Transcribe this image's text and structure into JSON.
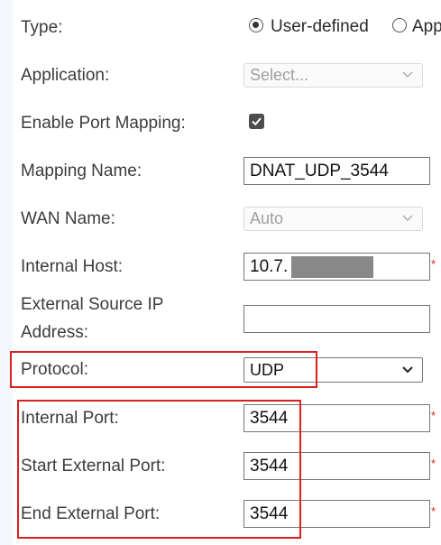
{
  "form": {
    "type": {
      "label": "Type:",
      "options": [
        "User-defined",
        "App"
      ],
      "selected": "User-defined"
    },
    "application": {
      "label": "Application:",
      "placeholder": "Select...",
      "disabled": true
    },
    "enable_port_mapping": {
      "label": "Enable Port Mapping:",
      "checked": true
    },
    "mapping_name": {
      "label": "Mapping Name:",
      "value": "DNAT_UDP_3544"
    },
    "wan_name": {
      "label": "WAN Name:",
      "value": "Auto",
      "disabled": true
    },
    "internal_host": {
      "label": "Internal Host:",
      "value": "10.7.",
      "required_mark": "*"
    },
    "external_source_ip": {
      "label_line1": "External Source IP",
      "label_line2": "Address:",
      "value": ""
    },
    "protocol": {
      "label": "Protocol:",
      "value": "UDP"
    },
    "internal_port": {
      "label": "Internal Port:",
      "value": "3544",
      "required_mark": "*"
    },
    "start_external_port": {
      "label": "Start External Port:",
      "value": "3544",
      "required_mark": "*"
    },
    "end_external_port": {
      "label": "End External Port:",
      "value": "3544",
      "required_mark": "*"
    }
  },
  "colors": {
    "highlight_box": "#d82020",
    "required": "#e02020"
  },
  "icons": {
    "select_arrow": "chevron-down-icon",
    "checkbox_check": "checkmark-icon",
    "redaction": "redaction-mask"
  }
}
